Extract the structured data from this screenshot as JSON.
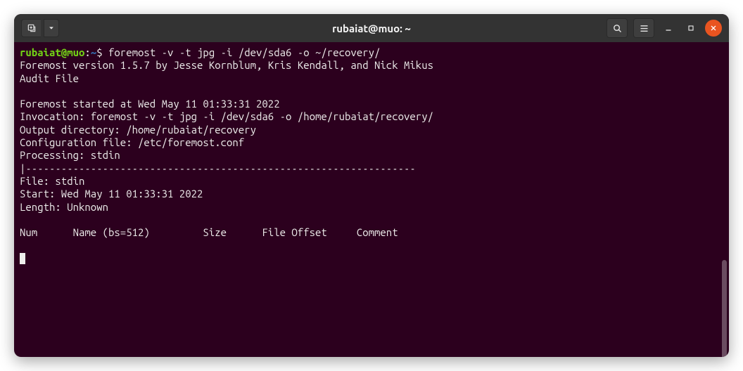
{
  "titlebar": {
    "title": "rubaiat@muo: ~"
  },
  "prompt": {
    "userhost": "rubaiat@muo",
    "sep": ":",
    "path": "~",
    "dollar": "$ ",
    "command": "foremost -v -t jpg -i /dev/sda6 -o ~/recovery/"
  },
  "output": {
    "l1": "Foremost version 1.5.7 by Jesse Kornblum, Kris Kendall, and Nick Mikus",
    "l2": "Audit File",
    "l3": "",
    "l4": "Foremost started at Wed May 11 01:33:31 2022",
    "l5": "Invocation: foremost -v -t jpg -i /dev/sda6 -o /home/rubaiat/recovery/",
    "l6": "Output directory: /home/rubaiat/recovery",
    "l7": "Configuration file: /etc/foremost.conf",
    "l8": "Processing: stdin",
    "l9": "|------------------------------------------------------------------",
    "l10": "File: stdin",
    "l11": "Start: Wed May 11 01:33:31 2022",
    "l12": "Length: Unknown",
    "l13": " ",
    "l14": "Num      Name (bs=512)         Size      File Offset     Comment ",
    "l15": ""
  }
}
